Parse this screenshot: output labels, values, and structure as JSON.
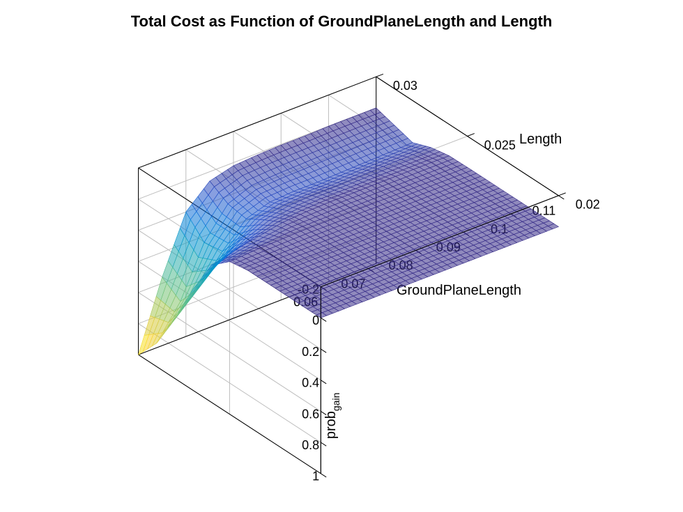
{
  "chart_data": {
    "type": "surface-mesh-3d",
    "title": "Total Cost as Function of GroundPlaneLength and Length",
    "xlabel": "GroundPlaneLength",
    "ylabel": "Length",
    "zlabel_main": "prob",
    "zlabel_sub": "gain",
    "x_ticks": [
      0.06,
      0.07,
      0.08,
      0.09,
      0.1,
      0.11
    ],
    "y_ticks": [
      0.02,
      0.025,
      0.03
    ],
    "z_ticks": [
      -0.2,
      0,
      0.2,
      0.4,
      0.6,
      0.8,
      1
    ],
    "xlim": [
      0.06,
      0.11
    ],
    "ylim": [
      0.02,
      0.03
    ],
    "zlim": [
      -0.2,
      1.0
    ],
    "colormap": "parula",
    "surface": {
      "description": "z = prob_gain(GroundPlaneLength, Length). Surface is ~0 over most of the domain; rises sharply as GroundPlaneLength -> 0.06 and Length -> 0.03, peaking near z ≈ 1.0 at (0.06, 0.03). A shallow secondary ridge (~0.05–0.1) runs along Length ≈ 0.028 for mid/high GroundPlaneLength.",
      "x_grid": [
        0.06,
        0.065,
        0.07,
        0.075,
        0.08,
        0.085,
        0.09,
        0.095,
        0.1,
        0.105,
        0.11
      ],
      "y_grid": [
        0.02,
        0.021,
        0.022,
        0.023,
        0.024,
        0.025,
        0.026,
        0.027,
        0.028,
        0.029,
        0.03
      ],
      "z_grid": [
        [
          0.0,
          0.0,
          0.0,
          0.0,
          0.0,
          0.02,
          0.12,
          0.35,
          0.62,
          0.85,
          1.0
        ],
        [
          0.0,
          0.0,
          0.0,
          0.0,
          0.0,
          0.01,
          0.08,
          0.25,
          0.48,
          0.64,
          0.56
        ],
        [
          0.0,
          0.0,
          0.0,
          0.0,
          0.0,
          0.005,
          0.05,
          0.15,
          0.3,
          0.32,
          0.2
        ],
        [
          0.0,
          0.0,
          0.0,
          0.0,
          0.0,
          0.0,
          0.02,
          0.08,
          0.15,
          0.13,
          0.06
        ],
        [
          0.0,
          0.0,
          0.0,
          0.0,
          0.0,
          0.0,
          0.01,
          0.05,
          0.1,
          0.07,
          0.02
        ],
        [
          0.0,
          0.0,
          0.0,
          0.0,
          0.0,
          0.0,
          0.005,
          0.04,
          0.09,
          0.06,
          0.01
        ],
        [
          0.0,
          0.0,
          0.0,
          0.0,
          0.0,
          0.0,
          0.005,
          0.04,
          0.09,
          0.055,
          0.005
        ],
        [
          0.0,
          0.0,
          0.0,
          0.0,
          0.0,
          0.0,
          0.003,
          0.035,
          0.085,
          0.05,
          0.005
        ],
        [
          0.0,
          0.0,
          0.0,
          0.0,
          0.0,
          0.0,
          0.003,
          0.03,
          0.08,
          0.045,
          0.0
        ],
        [
          0.0,
          0.0,
          0.0,
          0.0,
          0.0,
          0.0,
          0.002,
          0.028,
          0.075,
          0.04,
          0.0
        ],
        [
          0.0,
          0.0,
          0.0,
          0.0,
          0.0,
          0.0,
          0.002,
          0.025,
          0.07,
          0.035,
          0.0
        ]
      ]
    },
    "render": {
      "mesh_resolution": 41,
      "grid_on": true,
      "box_style": "matlab-default",
      "view": {
        "azimuth": -37.5,
        "elevation": 30
      }
    }
  }
}
